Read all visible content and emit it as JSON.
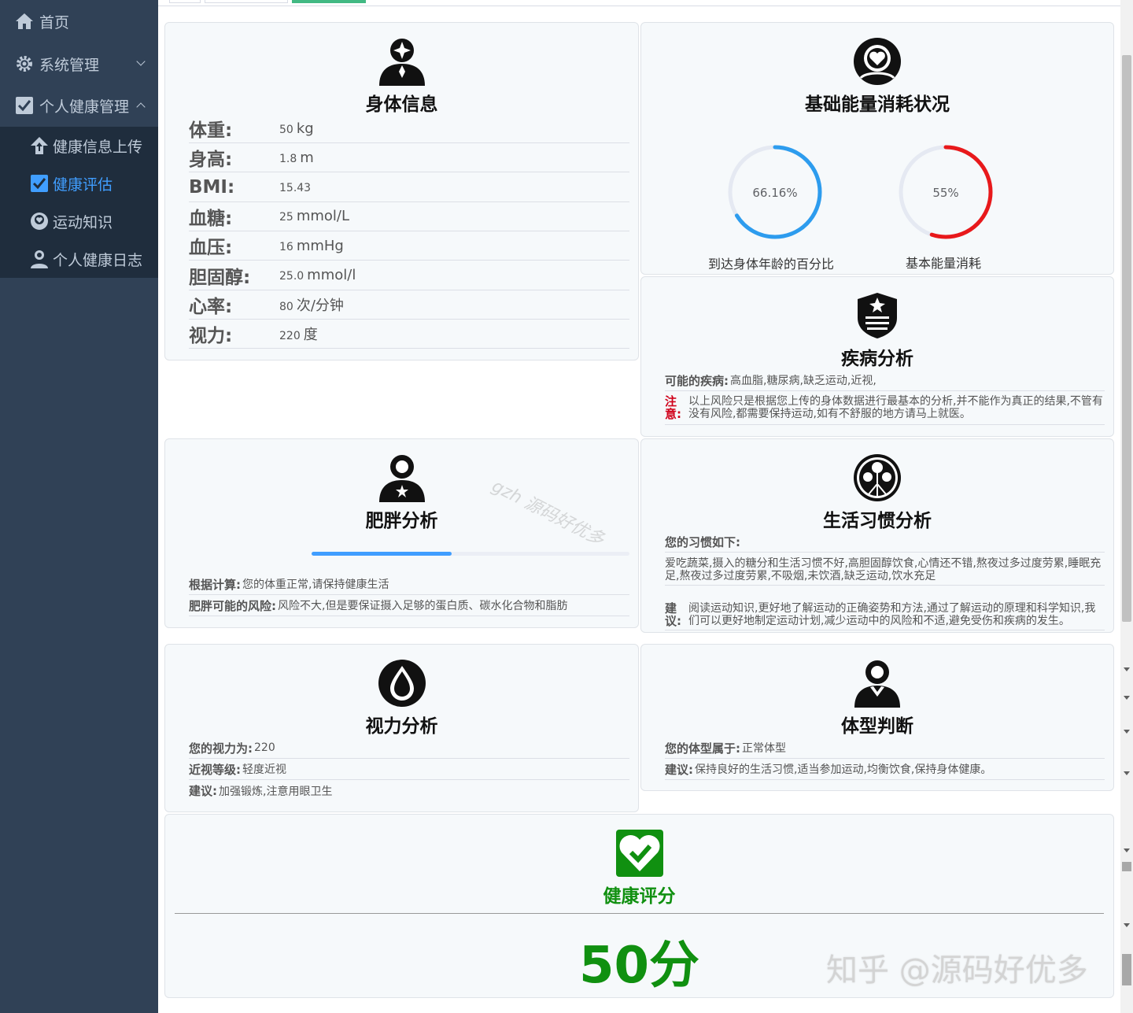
{
  "sidebar": {
    "items": [
      {
        "label": "首页",
        "icon": "home-icon"
      },
      {
        "label": "系统管理",
        "icon": "gear-icon"
      },
      {
        "label": "个人健康管理",
        "icon": "checkbox-icon"
      }
    ],
    "subitems": [
      {
        "label": "健康信息上传",
        "icon": "upload-icon"
      },
      {
        "label": "健康评估",
        "icon": "checkbox-icon",
        "active": true
      },
      {
        "label": "运动知识",
        "icon": "avatar-heart-icon"
      },
      {
        "label": "个人健康日志",
        "icon": "user-icon"
      }
    ]
  },
  "body_info": {
    "title": "身体信息",
    "rows": [
      {
        "label": "体重:",
        "num": "50",
        "unit": "kg"
      },
      {
        "label": "身高:",
        "num": "1.8",
        "unit": "m"
      },
      {
        "label": "BMI:",
        "num": "15.43",
        "unit": ""
      },
      {
        "label": "血糖:",
        "num": "25",
        "unit": "mmol/L"
      },
      {
        "label": "血压:",
        "num": "16",
        "unit": "mmHg"
      },
      {
        "label": "胆固醇:",
        "num": "25.0",
        "unit": "mmol/l"
      },
      {
        "label": "心率:",
        "num": "80",
        "unit": "次/分钟"
      },
      {
        "label": "视力:",
        "num": "220",
        "unit": "度"
      }
    ]
  },
  "energy": {
    "title": "基础能量消耗状况",
    "gauges": [
      {
        "text": "66.16%",
        "value": 66.16,
        "label": "到达身体年龄的百分比",
        "color": "#2d9cee"
      },
      {
        "text": "55%",
        "value": 55,
        "label": "基本能量消耗",
        "color": "#e8191b"
      }
    ]
  },
  "disease": {
    "title": "疾病分析",
    "possible_label": "可能的疾病:",
    "possible_value": "高血脂,糖尿病,缺乏运动,近视,",
    "note_label": "注意:",
    "note_text": "以上风险只是根据您上传的身体数据进行最基本的分析,并不能作为真正的结果,不管有没有风险,都需要保持运动,如有不舒服的地方请马上就医。"
  },
  "obesity": {
    "title": "肥胖分析",
    "progress": 0.44,
    "calc_label": "根据计算:",
    "calc_value": "您的体重正常,请保持健康生活",
    "risk_label": "肥胖可能的风险:",
    "risk_value": "风险不大,但是要保证摄入足够的蛋白质、碳水化合物和脂肪"
  },
  "habits": {
    "title": "生活习惯分析",
    "intro_label": "您的习惯如下:",
    "habits_text": "爱吃蔬菜,摄入的糖分和生活习惯不好,高胆固醇饮食,心情还不错,熬夜过多过度劳累,睡眠充足,熬夜过多过度劳累,不吸烟,未饮酒,缺乏运动,饮水充足",
    "advice_label": "建议:",
    "advice_text": "阅读运动知识,更好地了解运动的正确姿势和方法,通过了解运动的原理和科学知识,我们可以更好地制定运动计划,减少运动中的风险和不适,避免受伤和疾病的发生。"
  },
  "vision": {
    "title": "视力分析",
    "rows": [
      {
        "label": "您的视力为:",
        "value": "220"
      },
      {
        "label": "近视等级:",
        "value": "轻度近视"
      },
      {
        "label": "建议:",
        "value": "加强锻炼,注意用眼卫生"
      }
    ]
  },
  "body_type": {
    "title": "体型判断",
    "rows": [
      {
        "label": "您的体型属于:",
        "value": "正常体型"
      },
      {
        "label": "建议:",
        "value": "保持良好的生活习惯,适当参加运动,均衡饮食,保持身体健康。"
      }
    ]
  },
  "score": {
    "title": "健康评分",
    "value": "50分",
    "color": "#109010"
  },
  "watermarks": {
    "diagonal": "gzh 源码好优多",
    "corner": "知乎 @源码好优多"
  }
}
